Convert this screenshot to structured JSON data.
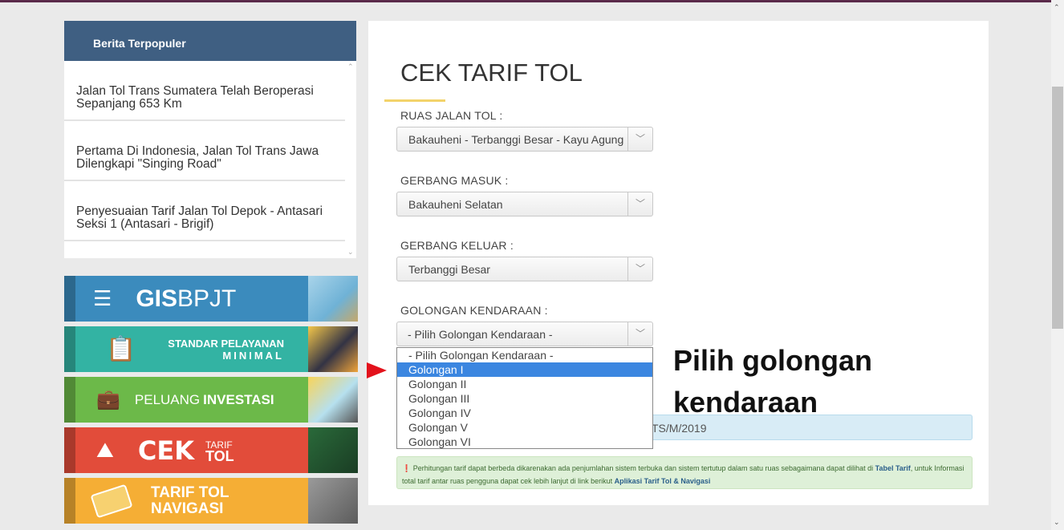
{
  "sidebar": {
    "popular_title": "Berita Terpopuler",
    "news": [
      "Jalan Tol Trans Sumatera Telah Beroperasi Sepanjang 653 Km",
      "Pertama Di Indonesia, Jalan Tol Trans Jawa Dilengkapi \"Singing Road\"",
      "Penyesuaian Tarif Jalan Tol Depok - Antasari Seksi 1 (Antasari - Brigif)"
    ],
    "banners": {
      "gis": {
        "bold": "GIS",
        "rest": " BPJT"
      },
      "spm": {
        "line1_a": "STANDAR ",
        "line1_b": "PELAYANAN",
        "line2": "MINIMAL"
      },
      "investasi": {
        "a": "PELUANG ",
        "b": "INVESTASI"
      },
      "cek": {
        "big": "CEK",
        "small1": "TARIF",
        "small2": "TOL"
      },
      "navigasi": {
        "line1": "TARIF TOL",
        "line2": "NAVIGASI"
      }
    }
  },
  "main": {
    "title": "CEK TARIF TOL",
    "ruas": {
      "label": "RUAS JALAN TOL :",
      "value": "Bakauheni - Terbanggi Besar - Kayu Agung"
    },
    "masuk": {
      "label": "GERBANG MASUK :",
      "value": "Bakauheni Selatan"
    },
    "keluar": {
      "label": "GERBANG KELUAR :",
      "value": "Terbanggi Besar"
    },
    "golongan": {
      "label": "GOLONGAN KENDARAAN :",
      "value": "- Pilih Golongan Kendaraan -",
      "options": [
        "- Pilih Golongan Kendaraan -",
        "Golongan I",
        "Golongan II",
        "Golongan III",
        "Golongan IV",
        "Golongan V",
        "Golongan VI"
      ],
      "highlighted_option": "Golongan I"
    },
    "info_text": "TS/M/2019",
    "note": {
      "icon": "info-icon",
      "text1": "Perhitungan tarif dapat berbeda dikarenakan ada penjumlahan sistem terbuka dan sistem tertutup dalam satu ruas sebagaimana dapat dilihat di ",
      "link1": "Tabel Tarif",
      "text2": ", untuk Informasi total tarif antar ruas pengguna dapat cek lebih lanjut di link berikut ",
      "link2": "Aplikasi Tarif Tol & Navigasi"
    }
  },
  "annotation": {
    "line1": "Pilih golongan",
    "line2": "kendaraan",
    "arrow_color": "#e3121c"
  },
  "colors": {
    "header_blue": "#3f5f82",
    "highlight": "#3b86e0"
  }
}
